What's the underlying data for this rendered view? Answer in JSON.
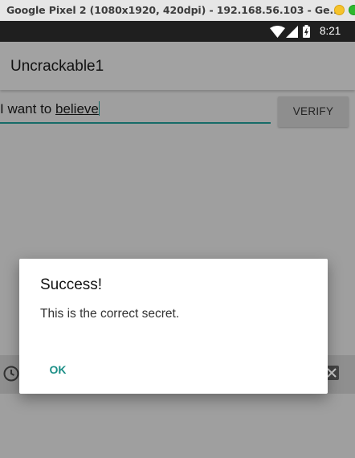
{
  "host_window": {
    "title": "Google Pixel 2 (1080x1920, 420dpi) - 192.168.56.103 - Ge..."
  },
  "status_bar": {
    "time": "8:21",
    "icons": [
      "wifi-icon",
      "signal-icon",
      "battery-charging-icon"
    ]
  },
  "app": {
    "title": "Uncrackable1",
    "input": {
      "value_part1": "I want to ",
      "value_part2": "believe"
    },
    "verify_button": "VERIFY"
  },
  "dialog": {
    "title": "Success!",
    "message": "This is the correct secret.",
    "ok_button": "OK"
  },
  "colors": {
    "accent": "#1c8f87",
    "dim_background": "#9f9f9f",
    "status_bar": "#1f1f1f"
  }
}
